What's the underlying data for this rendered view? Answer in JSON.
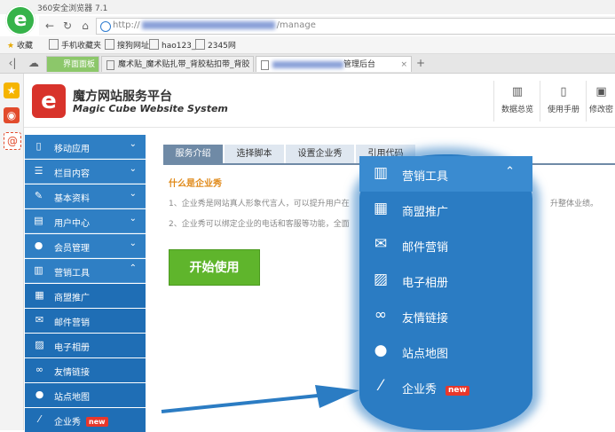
{
  "browser": {
    "title": "360安全浏览器 7.1",
    "logo": "e",
    "url_prefix": "http://",
    "url_suffix": "/manage",
    "bookmarks": [
      "收藏",
      "手机收藏夹",
      "搜狗网址",
      "hao123_",
      "2345网"
    ],
    "tabs": [
      {
        "label": "界面面板"
      },
      {
        "label": "魔术贴_魔术贴扎带_背胶粘扣带_背胶"
      },
      {
        "label": "管理后台",
        "active": true
      }
    ]
  },
  "header": {
    "brand_cn": "魔方网站服务平台",
    "brand_en": "Magic Cube Website System",
    "buttons": [
      {
        "label": "数据总览",
        "icon": "chart-icon"
      },
      {
        "label": "使用手册",
        "icon": "document-icon"
      },
      {
        "label": "修改密",
        "icon": "lock-icon"
      }
    ]
  },
  "sidebar": {
    "items": [
      {
        "label": "移动应用",
        "icon": "mobile-icon"
      },
      {
        "label": "栏目内容",
        "icon": "list-icon"
      },
      {
        "label": "基本资料",
        "icon": "edit-icon"
      },
      {
        "label": "用户中心",
        "icon": "user-card-icon"
      },
      {
        "label": "会员管理",
        "icon": "user-icon"
      },
      {
        "label": "营销工具",
        "icon": "chart-icon",
        "expanded": true
      }
    ],
    "subitems": [
      {
        "label": "商盟推广",
        "icon": "grid-icon"
      },
      {
        "label": "邮件营销",
        "icon": "envelope-icon"
      },
      {
        "label": "电子相册",
        "icon": "picture-icon"
      },
      {
        "label": "友情链接",
        "icon": "link-icon"
      },
      {
        "label": "站点地图",
        "icon": "map-marker-icon"
      },
      {
        "label": "企业秀",
        "icon": "magic-wand-icon",
        "badge": "new"
      }
    ]
  },
  "content": {
    "tabs": [
      "服务介绍",
      "选择脚本",
      "设置企业秀",
      "引用代码"
    ],
    "question": "什么是企业秀",
    "para1": "1、企业秀是网站真人形象代言人，可以提升用户在",
    "para1_end": "升整体业绩。",
    "para2": "2、企业秀可以绑定企业的电话和客服等功能，全面",
    "start_button": "开始使用"
  },
  "zoom": {
    "header": {
      "label": "营销工具",
      "icon": "chart-icon"
    },
    "items": [
      {
        "label": "商盟推广",
        "icon": "grid-icon"
      },
      {
        "label": "邮件营销",
        "icon": "envelope-icon"
      },
      {
        "label": "电子相册",
        "icon": "picture-icon"
      },
      {
        "label": "友情链接",
        "icon": "link-icon"
      },
      {
        "label": "站点地图",
        "icon": "map-marker-icon"
      },
      {
        "label": "企业秀",
        "icon": "magic-wand-icon",
        "badge": "new"
      }
    ]
  },
  "colors": {
    "sidebar": "#2f7fc4",
    "submenu": "#1f6eb5",
    "active_tab": "#6f8aa6",
    "start_button": "#5fb52c",
    "badge": "#e8372b"
  }
}
